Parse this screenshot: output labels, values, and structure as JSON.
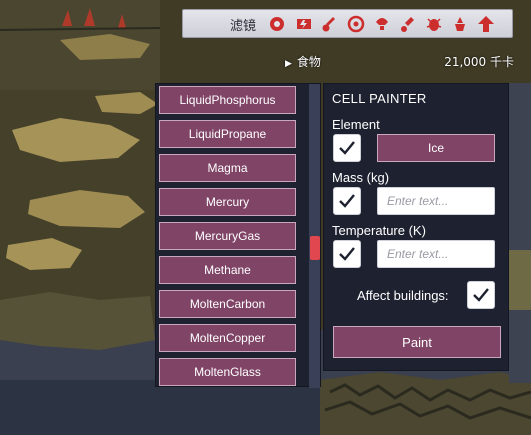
{
  "filter_bar": {
    "label": "滤镜",
    "icons": [
      "oxygen-overlay-icon",
      "power-overlay-icon",
      "temperature-overlay-icon",
      "materials-overlay-icon",
      "light-overlay-icon",
      "plumbing-overlay-icon",
      "germ-overlay-icon",
      "farming-overlay-icon",
      "rooms-overlay-icon"
    ]
  },
  "food": {
    "label": "食物",
    "calories": "21,000 千卡"
  },
  "element_list": {
    "items": [
      "LiquidPhosphorus",
      "LiquidPropane",
      "Magma",
      "Mercury",
      "MercuryGas",
      "Methane",
      "MoltenCarbon",
      "MoltenCopper",
      "MoltenGlass"
    ]
  },
  "cell_painter": {
    "title": "CELL PAINTER",
    "element_label": "Element",
    "element_value": "Ice",
    "mass_label": "Mass (kg)",
    "mass_placeholder": "Enter text...",
    "temperature_label": "Temperature (K)",
    "temperature_placeholder": "Enter text...",
    "affect_buildings_label": "Affect buildings:",
    "paint_label": "Paint",
    "element_checked": true,
    "mass_checked": true,
    "temperature_checked": true,
    "affect_buildings_checked": true
  },
  "colors": {
    "button": "#7f4466",
    "panel": "#1e2230",
    "scroll_thumb": "#e0474e",
    "filter_icon_red": "#cc2e2e"
  }
}
